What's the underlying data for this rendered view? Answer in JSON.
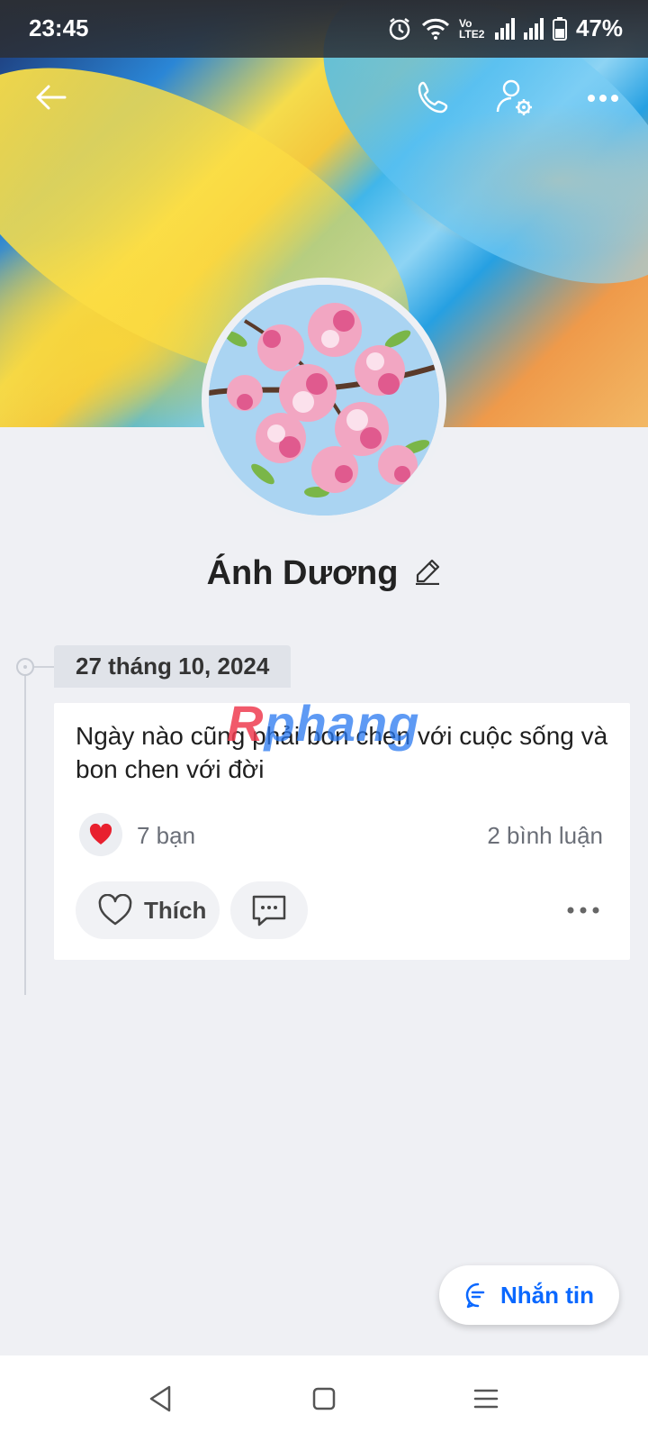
{
  "status_bar": {
    "time": "23:45",
    "battery": "47%",
    "network_label": "Vo LTE2",
    "icons": [
      "alarm-icon",
      "wifi-icon",
      "volte-icon",
      "signal-icon",
      "signal-icon",
      "battery-icon"
    ]
  },
  "header": {
    "actions": [
      "back-arrow-icon",
      "phone-icon",
      "user-settings-icon",
      "more-icon"
    ]
  },
  "profile": {
    "name": "Ánh Dương"
  },
  "timeline": {
    "date": "27 tháng 10, 2024"
  },
  "post": {
    "text": "Ngày nào cũng phải bon chen với cuộc sống và bon chen với đời",
    "reaction_count": "7 bạn",
    "comment_count": "2 bình luận",
    "like_label": "Thích"
  },
  "watermark": {
    "first": "R",
    "rest": "phang"
  },
  "message_button": {
    "label": "Nhắn tin"
  },
  "colors": {
    "accent": "#0a68ff",
    "background": "#eff0f4",
    "card": "#ffffff",
    "heart": "#e8202e"
  }
}
